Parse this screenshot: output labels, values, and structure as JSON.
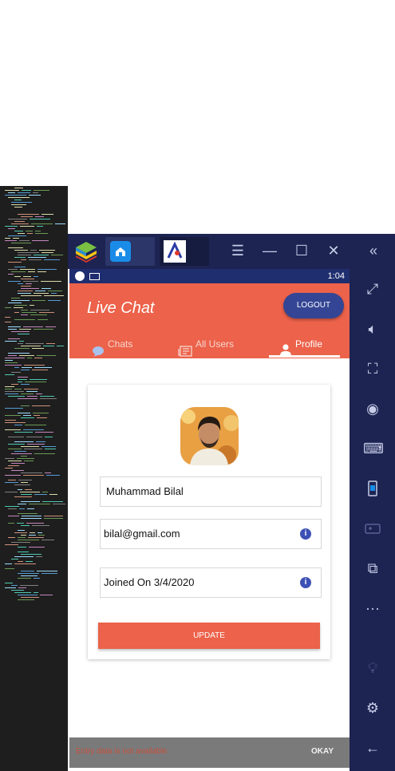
{
  "emulator": {
    "toolbar_icons": [
      "bluestacks-logo",
      "home-icon",
      "app-icon",
      "menu-icon",
      "minimize-icon",
      "maximize-icon",
      "close-icon",
      "collapse-icon"
    ],
    "sidebar_icons": [
      "fullscreen-icon",
      "volume-icon",
      "screenshot-icon",
      "eye-icon",
      "keyboard-icon",
      "rotate-icon",
      "gamepad-icon",
      "copy-icon",
      "more-icon",
      "bulb-icon",
      "settings-icon",
      "back-icon"
    ]
  },
  "status_bar": {
    "time": "1:04"
  },
  "app_bar": {
    "title": "Live Chat",
    "logout_label": "LOGOUT"
  },
  "tabs": [
    {
      "label": "Chats",
      "icon": "chat-bubble-icon"
    },
    {
      "label": "All Users",
      "icon": "newspaper-icon"
    },
    {
      "label": "Profile",
      "icon": "person-icon",
      "active": true
    }
  ],
  "profile": {
    "name": "Muhammad Bilal",
    "email": "bilal@gmail.com",
    "joined": "Joined On 3/4/2020",
    "update_label": "UPDATE"
  },
  "snackbar": {
    "message": "Entry data is not available",
    "action_label": "OKAY"
  },
  "colors": {
    "accent": "#ec624a",
    "navy": "#1f2e6f",
    "logout_bg": "#334594",
    "emulator_chrome": "#1d2452"
  }
}
